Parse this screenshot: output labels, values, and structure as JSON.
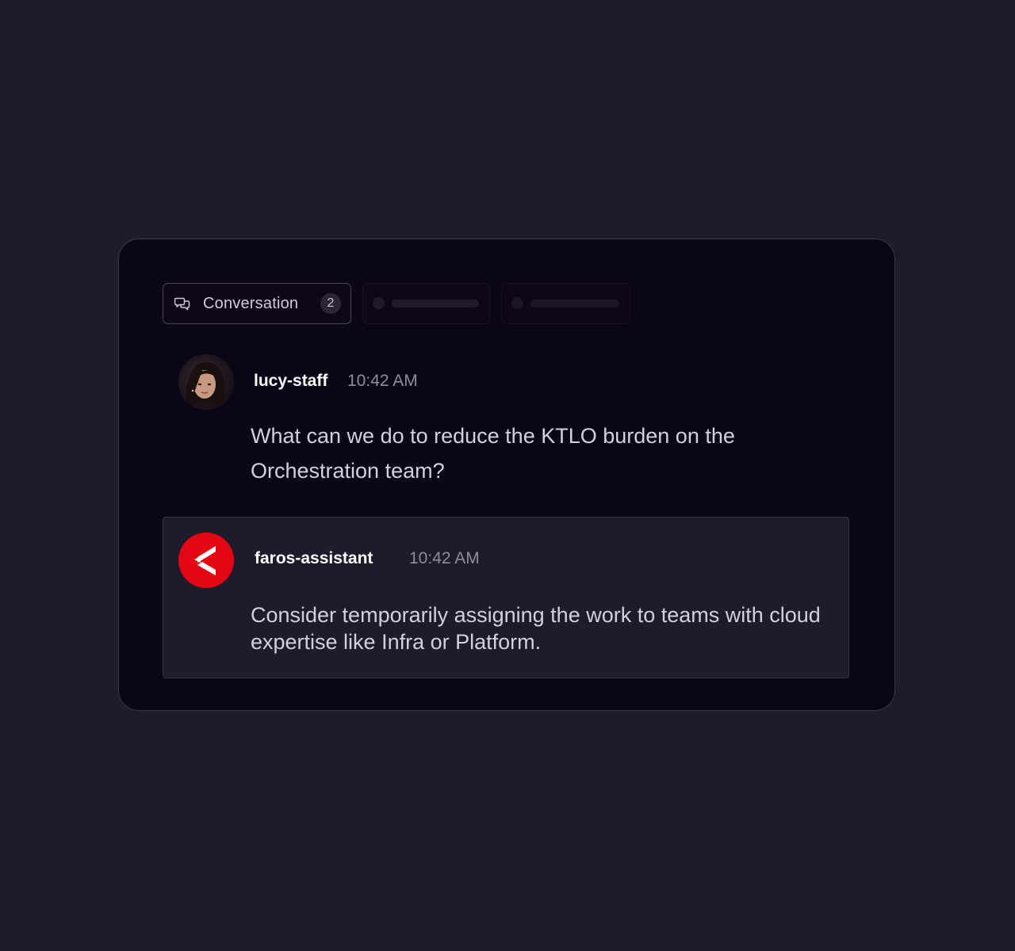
{
  "tabs": {
    "active": {
      "label": "Conversation",
      "count": "2",
      "icon": "chat-bubbles-icon"
    }
  },
  "messages": [
    {
      "author": "lucy-staff",
      "time": "10:42 AM",
      "text": "What can we do to reduce the KTLO burden on the Orchestration team?",
      "avatar": "user-photo-avatar"
    },
    {
      "author": "faros-assistant",
      "time": "10:42 AM",
      "text": "Consider temporarily assigning the work to teams with cloud expertise like Infra or Platform.",
      "avatar": "faros-logo-icon"
    }
  ],
  "colors": {
    "background": "#1e1b2c",
    "panel": "#0b0518",
    "brand_red": "#e30613"
  }
}
